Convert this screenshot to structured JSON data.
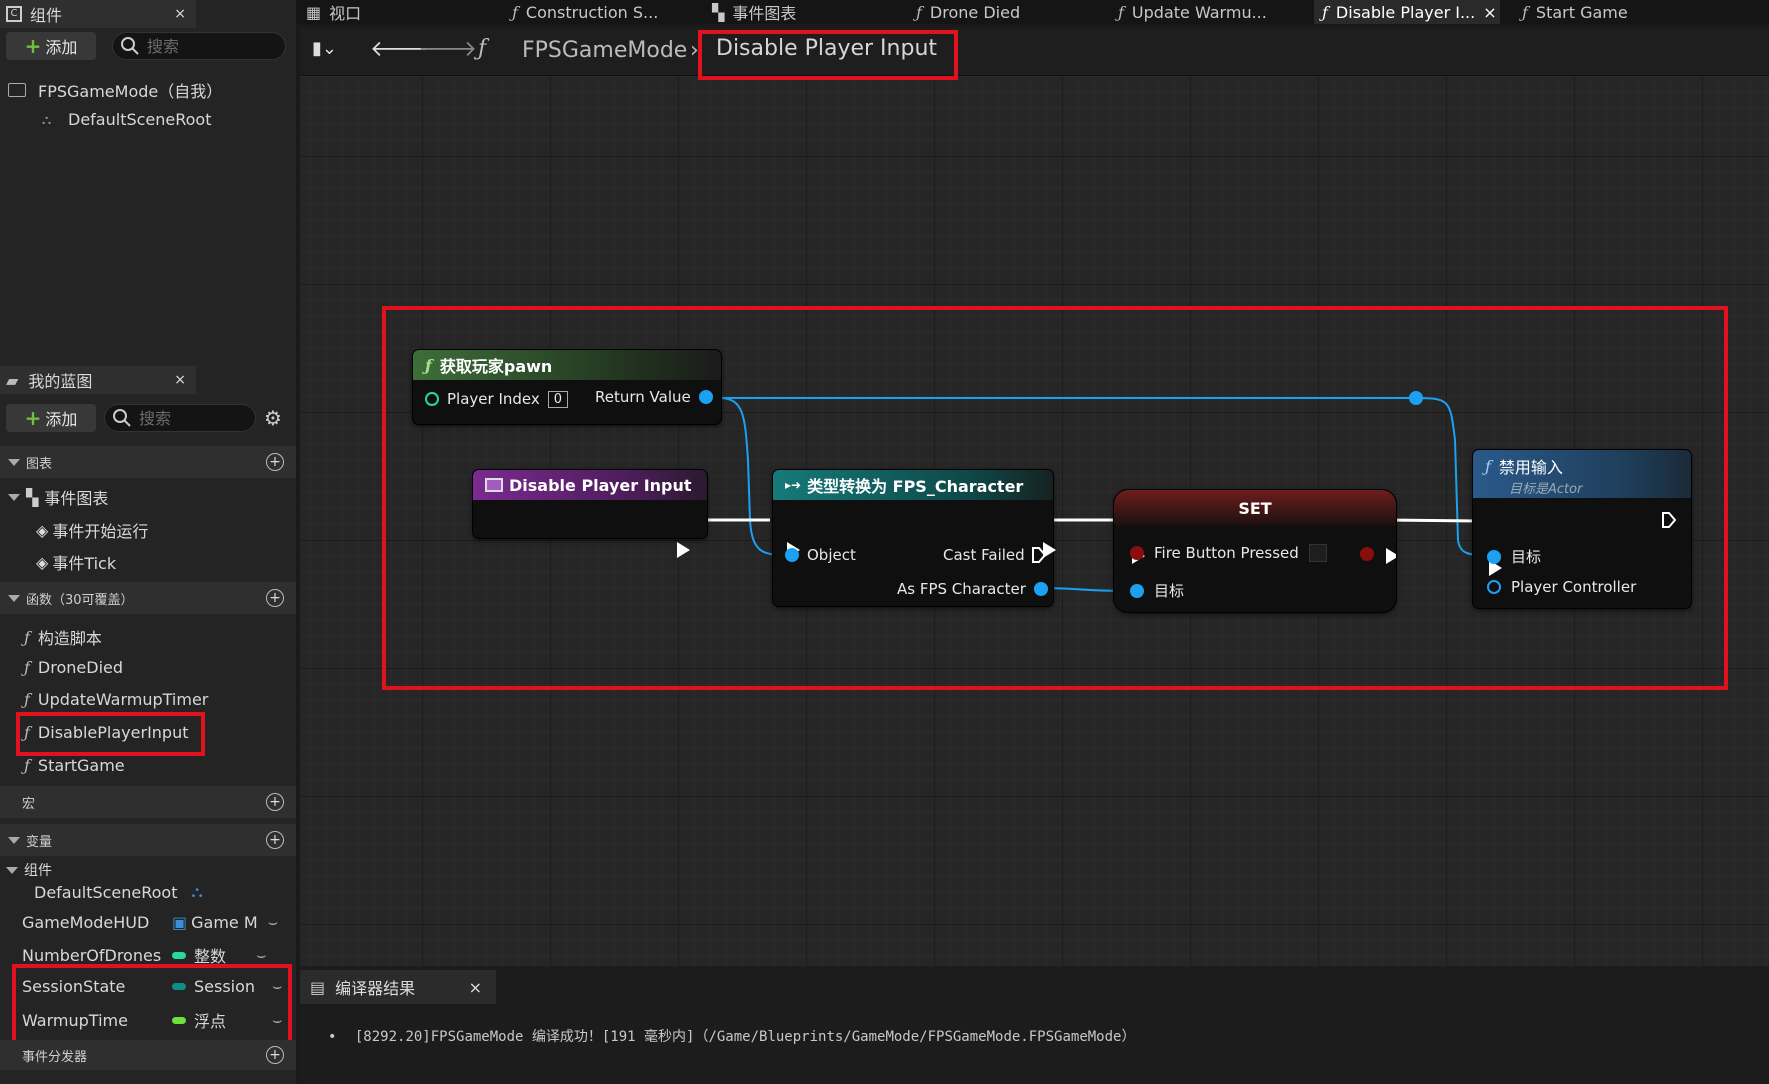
{
  "left": {
    "components_tab": {
      "title": "组件",
      "close": "×"
    },
    "components_add": "添加",
    "components_search_placeholder": "搜索",
    "tree": {
      "root": "FPSGameMode（自我）",
      "child": "DefaultSceneRoot"
    },
    "blueprint_tab": {
      "title": "我的蓝图",
      "close": "×"
    },
    "blueprint_add": "添加",
    "blueprint_search_placeholder": "搜索",
    "sections": {
      "graphs": "图表",
      "functions": "函数（30可覆盖）",
      "macros": "宏",
      "variables": "变量",
      "dispatchers": "事件分发器"
    },
    "graph_items": {
      "event_graph": "事件图表",
      "begin_play": "事件开始运行",
      "tick": "事件Tick"
    },
    "functions": [
      "构造脚本",
      "DroneDied",
      "UpdateWarmupTimer",
      "DisablePlayerInput",
      "StartGame"
    ],
    "var_group": "组件",
    "variables": [
      {
        "name": "DefaultSceneRoot",
        "type": "",
        "color": "#3b8fd6"
      },
      {
        "name": "GameModeHUD",
        "type": "Game M",
        "color": "#3b8fd6"
      },
      {
        "name": "NumberOfDrones",
        "type": "整数",
        "color": "#25d9a0"
      },
      {
        "name": "SessionState",
        "type": "Session",
        "color": "#0b8f85"
      },
      {
        "name": "WarmupTime",
        "type": "浮点",
        "color": "#6fe03a"
      }
    ]
  },
  "tabs": [
    {
      "label": "视口",
      "icon": "viewport-icon"
    },
    {
      "label": "Construction S...",
      "icon": "function-icon"
    },
    {
      "label": "事件图表",
      "icon": "event-graph-icon"
    },
    {
      "label": "Drone Died",
      "icon": "function-icon"
    },
    {
      "label": "Update Warmu...",
      "icon": "function-icon"
    },
    {
      "label": "Disable Player I...",
      "icon": "function-icon",
      "active": true,
      "close": "×"
    },
    {
      "label": "Start Game",
      "icon": "function-icon"
    }
  ],
  "breadcrumb": {
    "parent": "FPSGameMode",
    "separator": "›",
    "current": "Disable Player Input"
  },
  "nodes": {
    "get_pawn": {
      "title": "获取玩家pawn",
      "player_index_label": "Player Index",
      "player_index_value": "0",
      "return_value": "Return Value"
    },
    "entry": {
      "title": "Disable Player Input"
    },
    "cast": {
      "title": "类型转换为 FPS_Character",
      "object": "Object",
      "cast_failed": "Cast Failed",
      "as_fps": "As FPS Character"
    },
    "set": {
      "title": "SET",
      "fire_button": "Fire Button Pressed",
      "target": "目标"
    },
    "disable_input": {
      "title": "禁用输入",
      "subtitle": "目标是Actor",
      "target": "目标",
      "player_controller": "Player Controller"
    }
  },
  "compiler": {
    "tab": "编译器结果",
    "close": "×",
    "message": "[8292.20]FPSGameMode 编译成功！[191 毫秒内]（/Game/Blueprints/GameMode/FPSGameMode.FPSGameMode）"
  }
}
